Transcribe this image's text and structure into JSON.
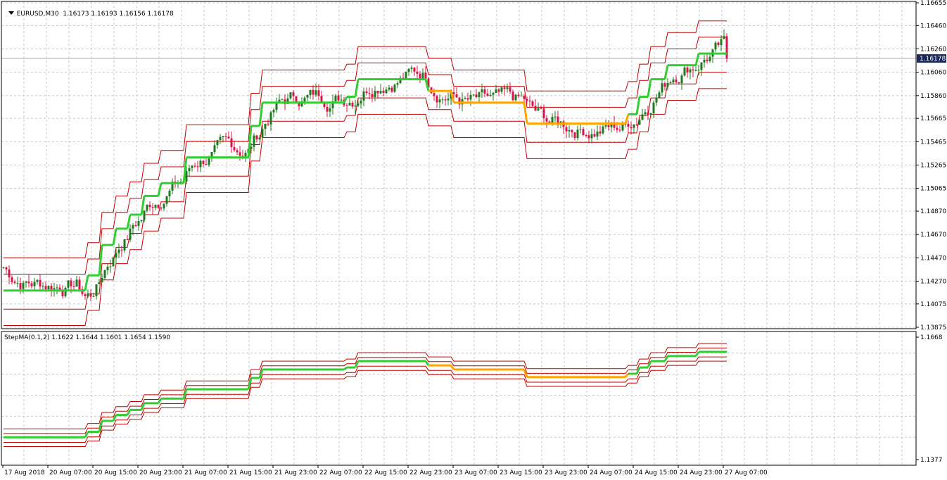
{
  "main_panel": {
    "symbol": "EURUSD,M30",
    "ohlc": "1.16173 1.16193 1.16156 1.16178",
    "price_ticks": [
      "1.16655",
      "1.16460",
      "1.16260",
      "1.16060",
      "1.15860",
      "1.15665",
      "1.15465",
      "1.15265",
      "1.15065",
      "1.14870",
      "1.14670",
      "1.14470",
      "1.14270",
      "1.14075",
      "1.13875"
    ],
    "current_price": "1.16178"
  },
  "indicator_panel": {
    "label": "StepMA(0.1,2) 1.1622 1.1644 1.1601 1.1654 1.1590",
    "ticks": [
      "1.1668",
      "1.1377"
    ]
  },
  "time_labels": [
    "17 Aug 2018",
    "20 Aug 07:00",
    "20 Aug 15:00",
    "20 Aug 23:00",
    "21 Aug 07:00",
    "21 Aug 15:00",
    "21 Aug 23:00",
    "22 Aug 07:00",
    "22 Aug 15:00",
    "22 Aug 23:00",
    "23 Aug 07:00",
    "23 Aug 15:00",
    "23 Aug 23:00",
    "24 Aug 07:00",
    "24 Aug 15:00",
    "24 Aug 23:00",
    "27 Aug 07:00"
  ],
  "colors": {
    "bull": "#1f7a1f",
    "bear": "#d4144a",
    "step_up": "#32cd32",
    "step_down": "#ffa500",
    "band": "#c00000",
    "grid": "#c8c8c8",
    "price_tag_bg": "#1a2a5a"
  },
  "chart_data": {
    "type": "candlestick",
    "title": "EURUSD,M30",
    "ylim": [
      1.13875,
      1.16655
    ],
    "step_ma": [
      {
        "bars": [
          0,
          30
        ],
        "value": 1.1419,
        "trend": "up"
      },
      {
        "bars": [
          30,
          35
        ],
        "value": 1.1432,
        "trend": "up"
      },
      {
        "bars": [
          35,
          40
        ],
        "value": 1.1458,
        "trend": "up"
      },
      {
        "bars": [
          40,
          45
        ],
        "value": 1.1472,
        "trend": "up"
      },
      {
        "bars": [
          45,
          50
        ],
        "value": 1.1484,
        "trend": "up"
      },
      {
        "bars": [
          50,
          56
        ],
        "value": 1.15,
        "trend": "up"
      },
      {
        "bars": [
          56,
          65
        ],
        "value": 1.1511,
        "trend": "up"
      },
      {
        "bars": [
          65,
          88
        ],
        "value": 1.1533,
        "trend": "up"
      },
      {
        "bars": [
          88,
          92
        ],
        "value": 1.156,
        "trend": "up"
      },
      {
        "bars": [
          92,
          122
        ],
        "value": 1.158,
        "trend": "up"
      },
      {
        "bars": [
          122,
          126
        ],
        "value": 1.1585,
        "trend": "up"
      },
      {
        "bars": [
          126,
          151
        ],
        "value": 1.16,
        "trend": "up"
      },
      {
        "bars": [
          151,
          160
        ],
        "value": 1.159,
        "trend": "down"
      },
      {
        "bars": [
          160,
          186
        ],
        "value": 1.158,
        "trend": "down"
      },
      {
        "bars": [
          186,
          222
        ],
        "value": 1.1562,
        "trend": "down"
      },
      {
        "bars": [
          222,
          226
        ],
        "value": 1.157,
        "trend": "up"
      },
      {
        "bars": [
          226,
          230
        ],
        "value": 1.1585,
        "trend": "up"
      },
      {
        "bars": [
          230,
          236
        ],
        "value": 1.16,
        "trend": "up"
      },
      {
        "bars": [
          236,
          247
        ],
        "value": 1.1612,
        "trend": "up"
      },
      {
        "bars": [
          247,
          258
        ],
        "value": 1.1622,
        "trend": "up"
      }
    ],
    "candles_summary": {
      "start_close": 1.1442,
      "low": 1.1393,
      "high": 1.1652,
      "last_close": 1.16178
    }
  }
}
